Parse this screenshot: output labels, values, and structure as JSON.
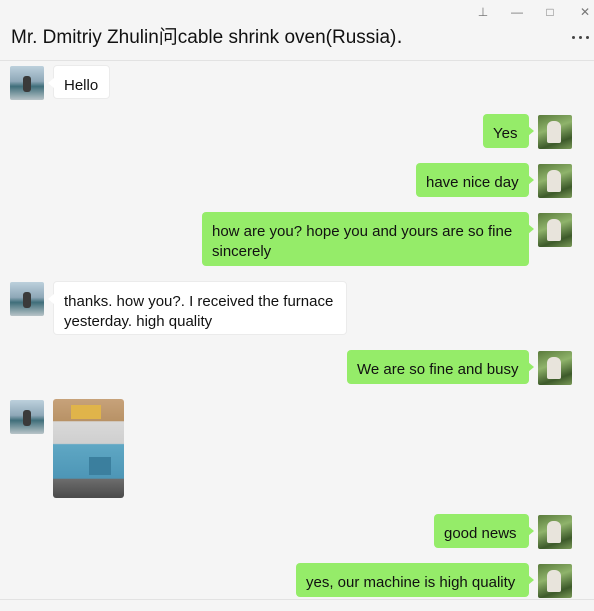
{
  "window": {
    "title": "Mr. Dmitriy Zhulin问cable shrink oven(Russia)․",
    "controls": {
      "pin": "⊥",
      "minimize": "—",
      "maximize": "□",
      "close": "✕"
    }
  },
  "messages": [
    {
      "side": "in",
      "text": "Hello"
    },
    {
      "side": "out",
      "text": "Yes"
    },
    {
      "side": "out",
      "text": "have nice day"
    },
    {
      "side": "out",
      "text": "how are you? hope you and yours are so fine sincerely"
    },
    {
      "side": "in",
      "text": "thanks. how you?. I received the furnace yesterday. high quality"
    },
    {
      "side": "out",
      "text": "We are so fine and busy"
    },
    {
      "side": "in",
      "type": "image",
      "image": "cable-shrink-oven-photo"
    },
    {
      "side": "out",
      "text": "good news"
    },
    {
      "side": "out",
      "text": "yes, our machine is high quality"
    }
  ],
  "colors": {
    "outgoing_bubble": "#95ec69",
    "incoming_bubble": "#ffffff",
    "background": "#f5f5f5"
  }
}
